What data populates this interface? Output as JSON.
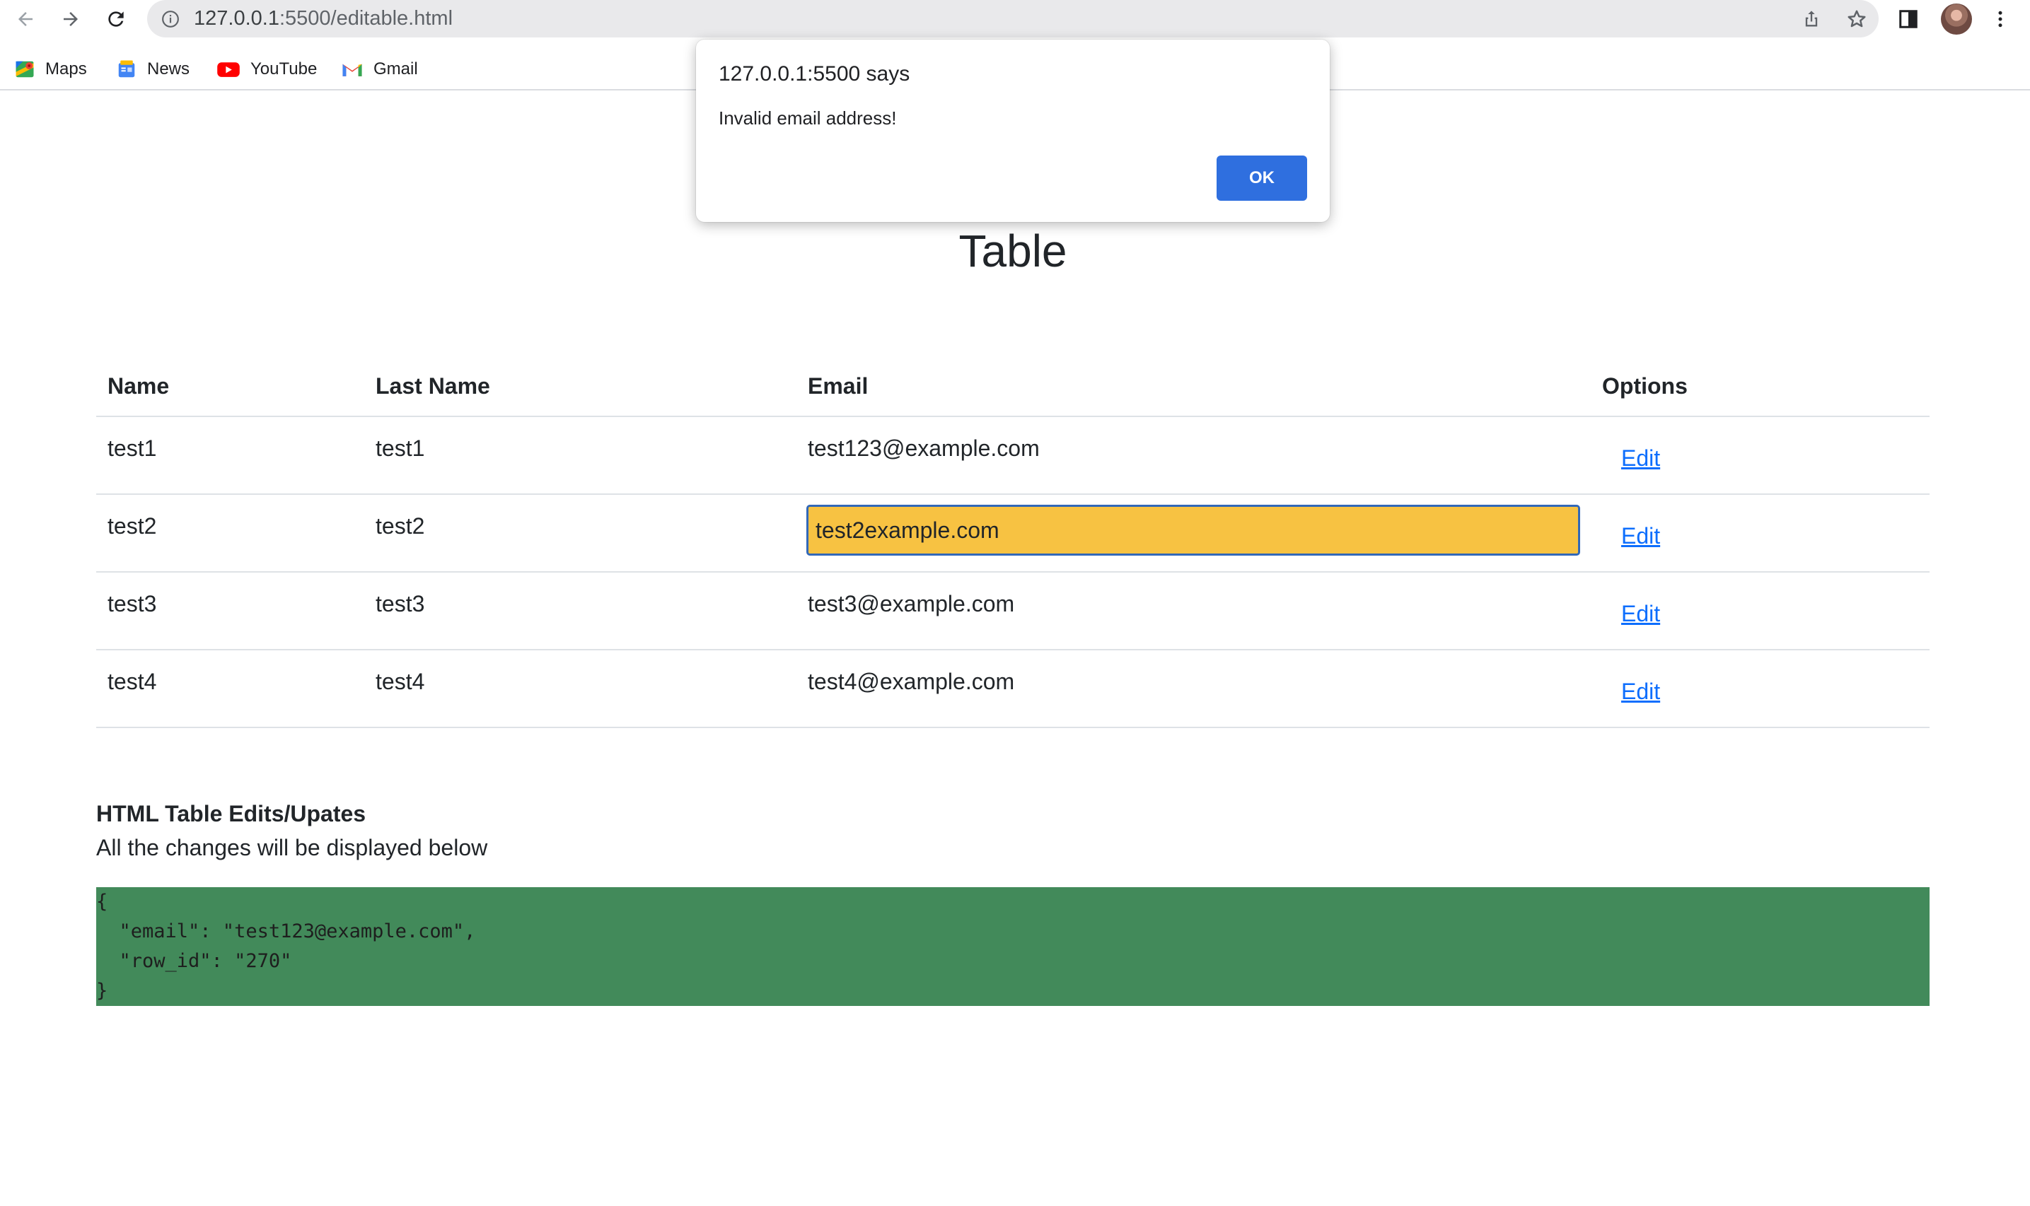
{
  "browser": {
    "url_host": "127.0.0.1",
    "url_rest": ":5500/editable.html",
    "bookmarks": [
      {
        "label": "Maps",
        "icon": "maps-icon"
      },
      {
        "label": "News",
        "icon": "news-icon"
      },
      {
        "label": "YouTube",
        "icon": "youtube-icon"
      },
      {
        "label": "Gmail",
        "icon": "gmail-icon"
      }
    ]
  },
  "page": {
    "title": "Table",
    "table": {
      "headers": [
        "Name",
        "Last Name",
        "Email",
        "Options"
      ],
      "rows": [
        {
          "name": "test1",
          "last_name": "test1",
          "email": "test123@example.com",
          "action": "Edit",
          "editing": false
        },
        {
          "name": "test2",
          "last_name": "test2",
          "email": "test2example.com",
          "action": "Edit",
          "editing": true
        },
        {
          "name": "test3",
          "last_name": "test3",
          "email": "test3@example.com",
          "action": "Edit",
          "editing": false
        },
        {
          "name": "test4",
          "last_name": "test4",
          "email": "test4@example.com",
          "action": "Edit",
          "editing": false
        }
      ]
    },
    "edits_title": "HTML Table Edits/Upates",
    "edits_description": "All the changes will be displayed below",
    "edits_output": "{\n  \"email\": \"test123@example.com\",\n  \"row_id\": \"270\"\n}"
  },
  "alert": {
    "title": "127.0.0.1:5500 says",
    "message": "Invalid email address!",
    "ok_label": "OK"
  },
  "colors": {
    "editing_input_bg": "#f7c242",
    "editing_input_border": "#3268b8",
    "output_bg": "#428a5a",
    "link": "#0d6efd",
    "ok_button": "#2f6fdf"
  }
}
